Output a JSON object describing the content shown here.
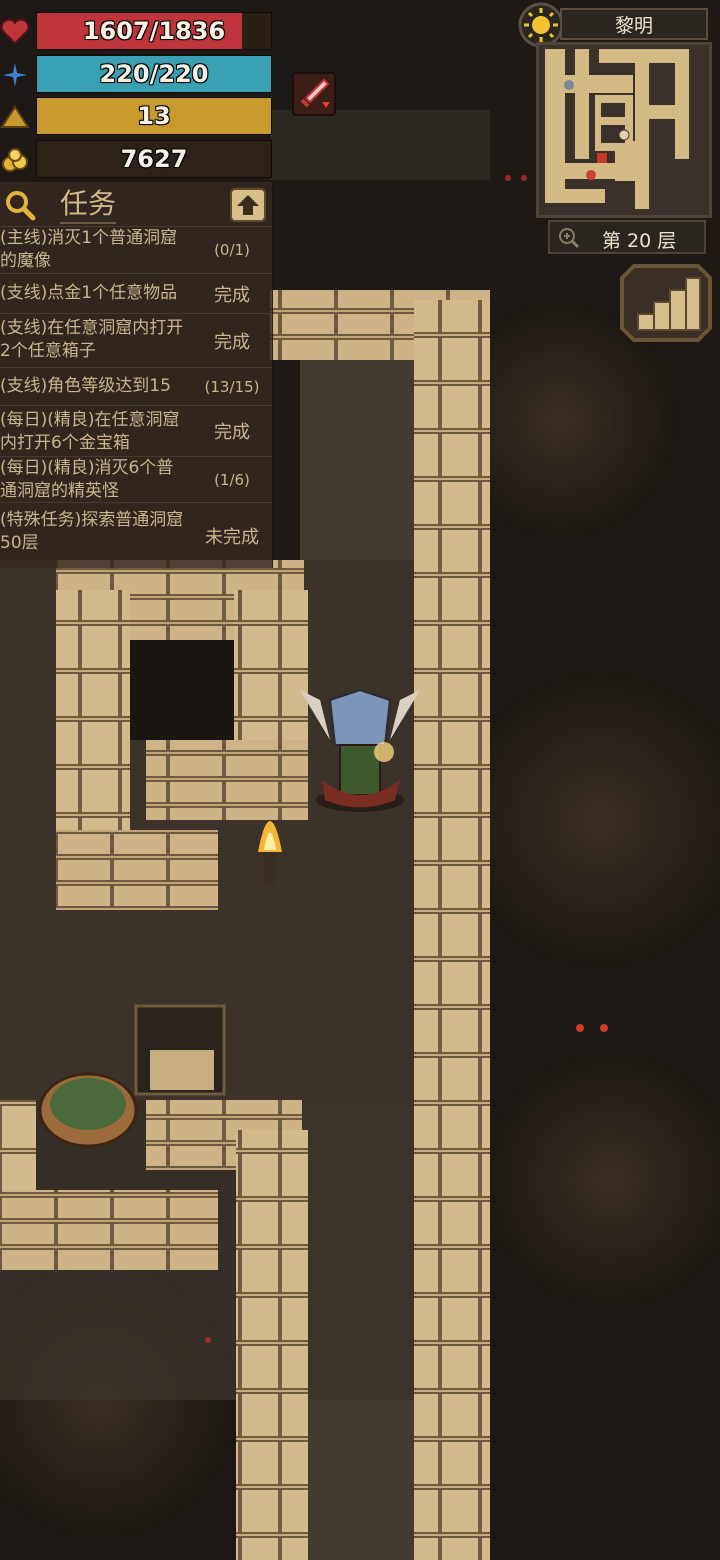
{
  "hud": {
    "hp": {
      "text": "1607/1836",
      "value": 1607,
      "max": 1836,
      "color": "#c0353a"
    },
    "mp": {
      "text": "220/220",
      "value": 220,
      "max": 220,
      "color": "#3aa0b4"
    },
    "level": {
      "text": "13",
      "fill": 1.0,
      "color": "#c89a2e"
    },
    "gold": {
      "text": "7627"
    },
    "icons": [
      "heart-icon",
      "mana-sparkle-icon",
      "level-triangle-icon",
      "gold-coins-icon"
    ]
  },
  "weapon_button": {
    "icon": "sword-down-icon"
  },
  "quests": {
    "title": "任务",
    "items": [
      {
        "text": "(主线)消灭1个普通洞窟的魔像",
        "status": "(0/1)"
      },
      {
        "text": "(支线)点金1个任意物品",
        "status": "完成"
      },
      {
        "text": "(支线)在任意洞窟内打开2个任意箱子",
        "status": "完成"
      },
      {
        "text": "(支线)角色等级达到15",
        "status": "(13/15)"
      },
      {
        "text": "(每日)(精良)在任意洞窟内打开6个金宝箱",
        "status": "完成"
      },
      {
        "text": "(每日)(精良)消灭6个普通洞窟的精英怪",
        "status": "(1/6)"
      },
      {
        "text": "(特殊任务)探索普通洞窟50层",
        "status": "未完成"
      }
    ]
  },
  "minimap": {
    "time_of_day": "黎明",
    "floor": "第 20 层"
  }
}
